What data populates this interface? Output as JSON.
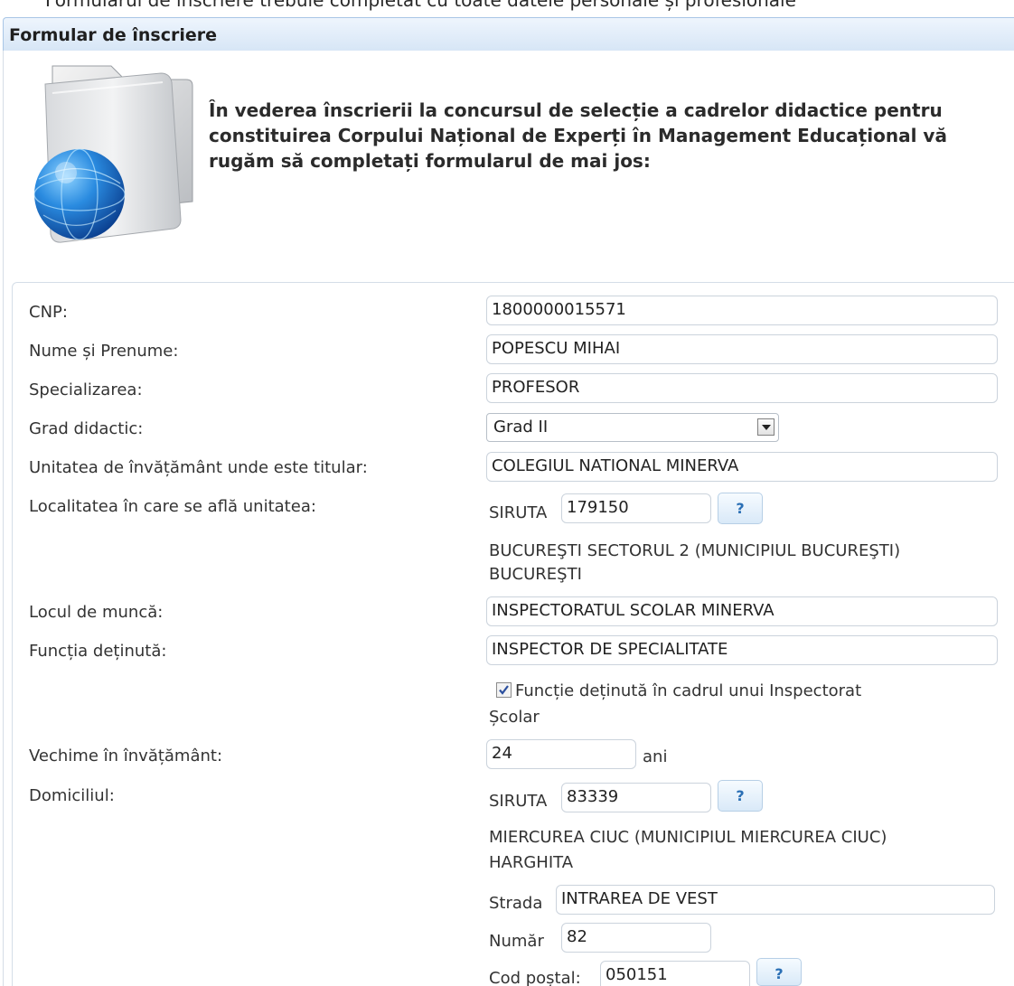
{
  "window": {
    "cut_text": "Formularul de înscriere trebuie completat cu toate datele personale și profesionale",
    "title": "Formular de înscriere"
  },
  "intro": {
    "text": "În vederea înscrierii la concursul de selecție a cadrelor didactice pentru constituirea Corpului Național de Experți în Management Educațional vă rugăm să completați formularul de mai jos:"
  },
  "form": {
    "cnp": {
      "label": "CNP:",
      "value": "1800000015571"
    },
    "name": {
      "label": "Nume și Prenume:",
      "value": "POPESCU MIHAI"
    },
    "specialization": {
      "label": "Specializarea:",
      "value": "PROFESOR"
    },
    "grade": {
      "label": "Grad didactic:",
      "value": "Grad II"
    },
    "unit": {
      "label": "Unitatea de învățământ unde este titular:",
      "value": "COLEGIUL NATIONAL MINERVA"
    },
    "unit_locality": {
      "label": "Localitatea în care se află unitatea:",
      "siruta_label": "SIRUTA",
      "siruta_value": "179150",
      "help_label": "?",
      "locality_line1": "BUCUREŞTI SECTORUL 2 (MUNICIPIUL BUCUREŞTI)",
      "locality_line2": "BUCUREŞTI"
    },
    "workplace": {
      "label": "Locul de muncă:",
      "value": "INSPECTORATUL SCOLAR MINERVA"
    },
    "position": {
      "label": "Funcția deținută:",
      "value": "INSPECTOR DE SPECIALITATE",
      "checkbox_checked": true,
      "checkbox_line1": "Funcție deținută în cadrul unui Inspectorat",
      "checkbox_line2": "Școlar"
    },
    "seniority": {
      "label": "Vechime în învățământ:",
      "value": "24",
      "unit": "ani"
    },
    "domicile": {
      "label": "Domiciliul:",
      "siruta_label": "SIRUTA",
      "siruta_value": "83339",
      "help_label": "?",
      "locality_line1": "MIERCUREA CIUC (MUNICIPIUL MIERCUREA CIUC)",
      "locality_line2": "HARGHITA",
      "street_label": "Strada",
      "street_value": "INTRAREA DE VEST",
      "number_label": "Număr",
      "number_value": "82",
      "postal_label": "Cod poștal:",
      "postal_value": "050151",
      "postal_help_label": "?"
    }
  },
  "colors": {
    "title_bar": "#d7e6f6",
    "help_button_text": "#2a6fb5",
    "input_border": "#cbd3dc"
  },
  "icons": {
    "header_icon": "folder-globe-icon",
    "checkbox_mark": "check-icon"
  }
}
